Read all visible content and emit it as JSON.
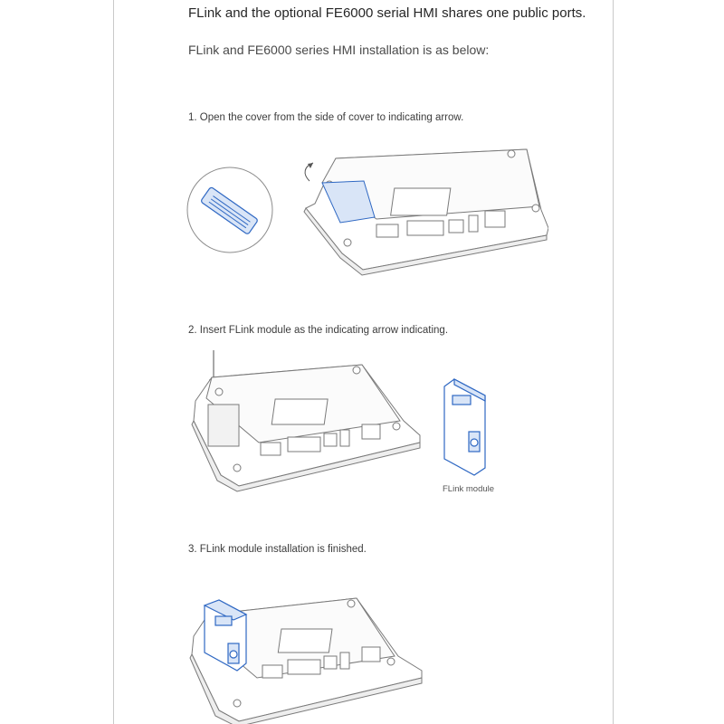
{
  "intro": {
    "line1": "FLink and the optional FE6000 serial HMI shares one public ports.",
    "line2": "FLink and FE6000 series HMI installation is as below:"
  },
  "steps": [
    {
      "text": "1. Open the cover from the side of cover to indicating arrow."
    },
    {
      "text": "2. Insert FLink module as the indicating arrow indicating."
    },
    {
      "text": "3. FLink module installation is finished."
    }
  ],
  "figure2": {
    "caption": "FLink module"
  },
  "colors": {
    "accent_blue": "#2f68c3",
    "line_gray": "#7a7a7a",
    "arrow_gray": "#8a8a8a"
  }
}
